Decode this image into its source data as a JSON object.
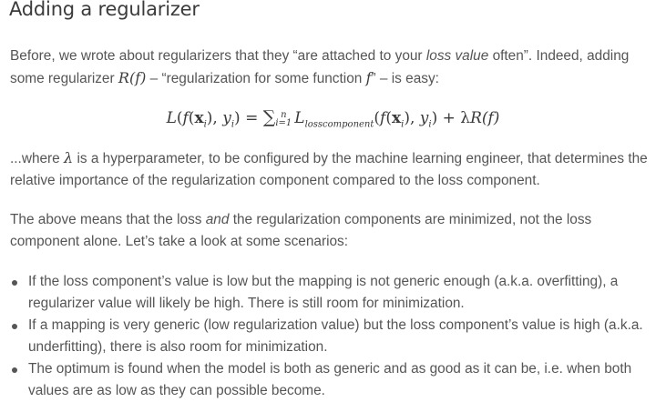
{
  "heading": "Adding a regularizer",
  "p1": {
    "t1": "Before, we wrote about regularizers that they “are attached to your ",
    "t1_em": "loss value",
    "t2": " often”. Indeed, adding some regularizer ",
    "m_R": "R",
    "m_f1": "(f)",
    "t3": " – “regularization for some function ",
    "m_f2": "f",
    "t4": "” – is easy:"
  },
  "formula": {
    "L": "L",
    "paren_open": "(",
    "f": "f",
    "x": "x",
    "i_sub": "i",
    "comma_y": "), ",
    "y": "y",
    "eq": ") = ",
    "sum": "∑",
    "sum_sup": "n",
    "sum_sub": "i=1",
    "Lloss": "L",
    "loss_sub": "losscomponent",
    "plus": " + ",
    "lambda": "λ",
    "R": "R",
    "fclose": "(f)"
  },
  "p2": {
    "t1": "...where ",
    "m_lambda": "λ",
    "t2": " is a hyperparameter, to be configured by the machine learning engineer, that determines the relative importance of the regularization component compared to the loss component."
  },
  "p3": {
    "t1": "The above means that the loss ",
    "em": "and",
    "t2": " the regularization components are minimized, not the loss component alone. Let’s take a look at some scenarios:"
  },
  "bullets": [
    "If the loss component’s value is low but the mapping is not generic enough (a.k.a. overfitting), a regularizer value will likely be high. There is still room for minimization.",
    "If a mapping is very generic (low regularization value) but the loss component’s value is high (a.k.a. underfitting), there is also room for minimization.",
    "The optimum is found when the model is both as generic and as good as it can be, i.e. when both values are as low as they can possible become."
  ]
}
